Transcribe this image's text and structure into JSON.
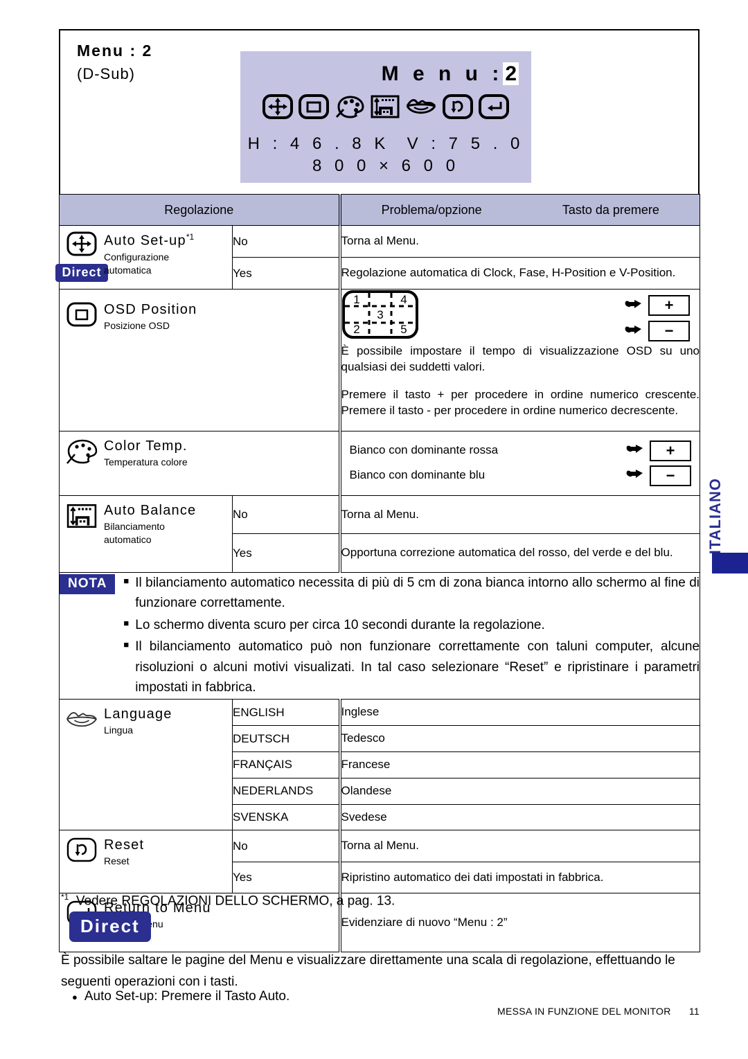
{
  "page": {
    "menu_title": "Menu : 2",
    "menu_subtitle": "(D-Sub)",
    "side_tab": "ITALIANO",
    "footer_title": "MESSA IN FUNZIONE DEL MONITOR",
    "footer_page": "11",
    "footnote_marker": "*1",
    "footnote_text": "Vedere REGOLAZIONI DELLO SCHERMO, a pag. 13."
  },
  "osd_preview": {
    "menu_label": "M e n u :",
    "menu_value": "2",
    "h_freq": "H : 4 6 . 8 K",
    "v_freq": "V : 7 5 . 0",
    "resolution": "8 0 0  ×  6 0 0",
    "icons": [
      "auto-setup-icon",
      "osd-position-icon",
      "color-temp-icon",
      "auto-balance-icon",
      "language-icon",
      "reset-icon",
      "return-to-menu-icon"
    ],
    "panel_color": "#c5c3e2"
  },
  "table": {
    "headers": {
      "adjustment": "Regolazione",
      "problem": "Problema/opzione",
      "key": "Tasto da premere"
    },
    "rows": [
      {
        "id": "auto-setup",
        "icon": "auto-setup-icon",
        "label_en": "Auto Set-up",
        "label_sup": "*1",
        "label_it": "Configurazione\nautomatica",
        "badge": "Direct",
        "options": [
          {
            "option": "No",
            "desc": "Torna al Menu."
          },
          {
            "option": "Yes",
            "desc": "Regolazione automatica di Clock, Fase, H-Position e V-Position."
          }
        ]
      },
      {
        "id": "osd-position",
        "icon": "osd-position-icon",
        "label_en": "OSD Position",
        "label_it": "Posizione OSD",
        "diagram_cells": [
          "1",
          "4",
          "3",
          "2",
          "5"
        ],
        "desc_lines": [
          "È possibile impostare il tempo di visualizzazione OSD su uno qualsiasi dei suddetti valori.",
          "Premere il tasto + per procedere in ordine numerico crescente. Premere il tasto - per procedere in ordine numerico decrescente."
        ],
        "keys": [
          "+",
          "−"
        ]
      },
      {
        "id": "color-temp",
        "icon": "color-temp-icon",
        "label_en": "Color Temp.",
        "label_it": "Temperatura colore",
        "options": [
          {
            "desc": "Bianco con dominante rossa",
            "key": "+"
          },
          {
            "desc": "Bianco con dominante blu",
            "key": "−"
          }
        ]
      },
      {
        "id": "auto-balance",
        "icon": "auto-balance-icon",
        "label_en": "Auto Balance",
        "label_it": "Bilanciamento\nautomatico",
        "options": [
          {
            "option": "No",
            "desc": "Torna al Menu."
          },
          {
            "option": "Yes",
            "desc": "Opportuna correzione automatica del rosso, del verde e del blu."
          }
        ]
      },
      {
        "id": "language",
        "icon": "language-icon",
        "label_en": "Language",
        "label_it": "Lingua",
        "options": [
          {
            "option": "ENGLISH",
            "desc": "Inglese"
          },
          {
            "option": "DEUTSCH",
            "desc": "Tedesco"
          },
          {
            "option": "FRANÇAIS",
            "desc": "Francese"
          },
          {
            "option": "NEDERLANDS",
            "desc": "Olandese"
          },
          {
            "option": "SVENSKA",
            "desc": "Svedese"
          }
        ]
      },
      {
        "id": "reset",
        "icon": "reset-icon",
        "label_en": "Reset",
        "label_it": "Reset",
        "options": [
          {
            "option": "No",
            "desc": "Torna al Menu."
          },
          {
            "option": "Yes",
            "desc": "Ripristino automatico dei dati impostati in fabbrica."
          }
        ]
      },
      {
        "id": "return-to-menu",
        "icon": "return-to-menu-icon",
        "label_en": "Return to Menu",
        "label_it": "Torna a Menu",
        "options": [
          {
            "desc": "Evidenziare di nuovo “Menu : 2”"
          }
        ]
      }
    ]
  },
  "nota": {
    "badge": "NOTA",
    "items": [
      "Il bilanciamento automatico necessita di più di 5 cm di zona bianca intorno allo schermo al  fine di funzionare correttamente.",
      "Lo schermo diventa scuro per circa 10 secondi durante la regolazione.",
      "Il bilanciamento automatico può non funzionare correttamente con taluni computer, alcune risoluzioni o alcuni motivi visualizati. In tal caso selezionare “Reset” e ripristinare i parametri impostati in fabbrica."
    ]
  },
  "direct_section": {
    "badge": "Direct",
    "paragraph": "È possibile saltare le pagine del Menu e visualizzare direttamente una scala di regolazione, effettuando le seguenti operazioni con i tasti.",
    "bullet": "Auto Set-up: Premere il Tasto Auto."
  },
  "colors": {
    "header_fill": "#b9bcd9",
    "osd_fill": "#c5c3e2",
    "badge_blue": "#2b2f8f",
    "tab_blue": "#1a2390"
  }
}
